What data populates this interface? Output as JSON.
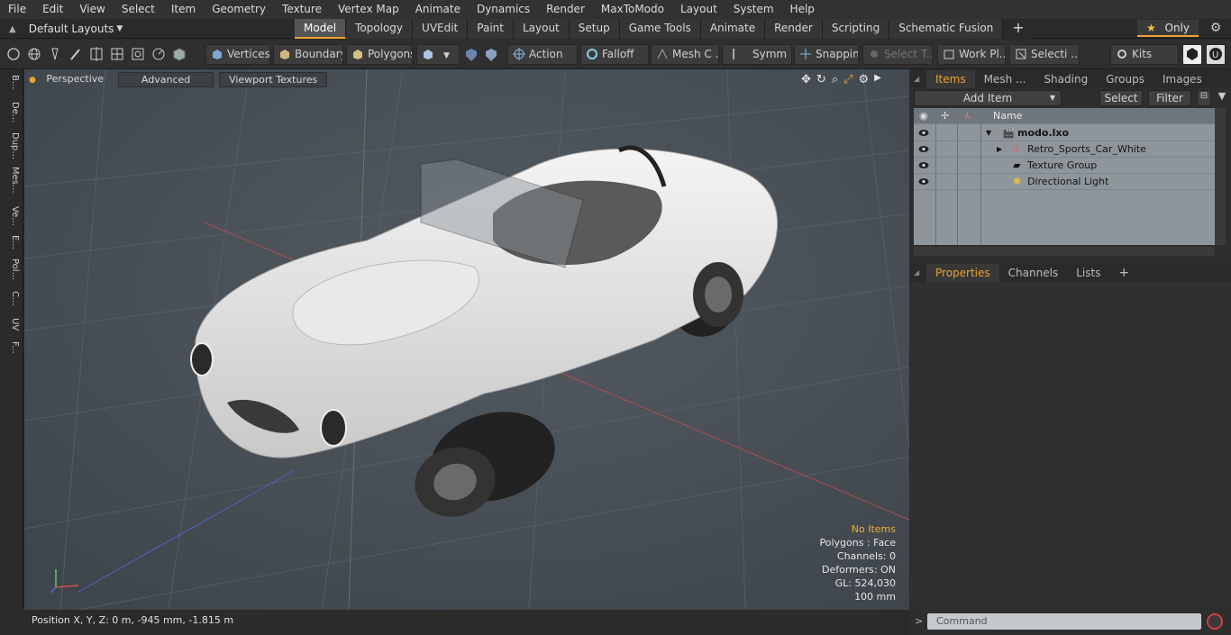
{
  "menu": [
    "File",
    "Edit",
    "View",
    "Select",
    "Item",
    "Geometry",
    "Texture",
    "Vertex Map",
    "Animate",
    "Dynamics",
    "Render",
    "MaxToModo",
    "Layout",
    "System",
    "Help"
  ],
  "layouts_label": "Default Layouts",
  "tabs": [
    "Model",
    "Topology",
    "UVEdit",
    "Paint",
    "Layout",
    "Setup",
    "Game Tools",
    "Animate",
    "Render",
    "Scripting",
    "Schematic Fusion"
  ],
  "active_tab": "Model",
  "only_label": "Only",
  "toolbar": {
    "vertices": "Vertices",
    "boundary": "Boundary",
    "polygons": "Polygons",
    "action": "Action",
    "falloff": "Falloff",
    "mesh": "Mesh C ...",
    "symm": "Symm ...",
    "snapping": "Snapping",
    "select_t": "Select T...",
    "work_pl": "Work Pl...",
    "selecti": "Selecti ...",
    "kits": "Kits"
  },
  "left_tabs": [
    "B...",
    "De...",
    "Dup...",
    "Mes...",
    "Ve...",
    "E...",
    "Pol...",
    "C...",
    "UV",
    "F..."
  ],
  "viewport": {
    "perspective": "Perspective",
    "advanced": "Advanced",
    "textures": "Viewport Textures",
    "info": [
      "No Items",
      "Polygons : Face",
      "Channels: 0",
      "Deformers: ON",
      "GL: 524,030",
      "100 mm"
    ]
  },
  "status": "Position X, Y, Z:   0 m, -945 mm, -1.815 m",
  "items_panel": {
    "tabs": [
      "Items",
      "Mesh ...",
      "Shading",
      "Groups",
      "Images"
    ],
    "add_item": "Add Item",
    "select": "Select",
    "filter": "Filter",
    "name_header": "Name",
    "rows": [
      "modo.lxo",
      "Retro_Sports_Car_White",
      "Texture Group",
      "Directional Light"
    ]
  },
  "props_panel": {
    "tabs": [
      "Properties",
      "Channels",
      "Lists"
    ]
  },
  "command_placeholder": "Command",
  "colors": {
    "accent": "#f0a030",
    "viewport": "#454c52",
    "items_bg": "#8e969c"
  }
}
